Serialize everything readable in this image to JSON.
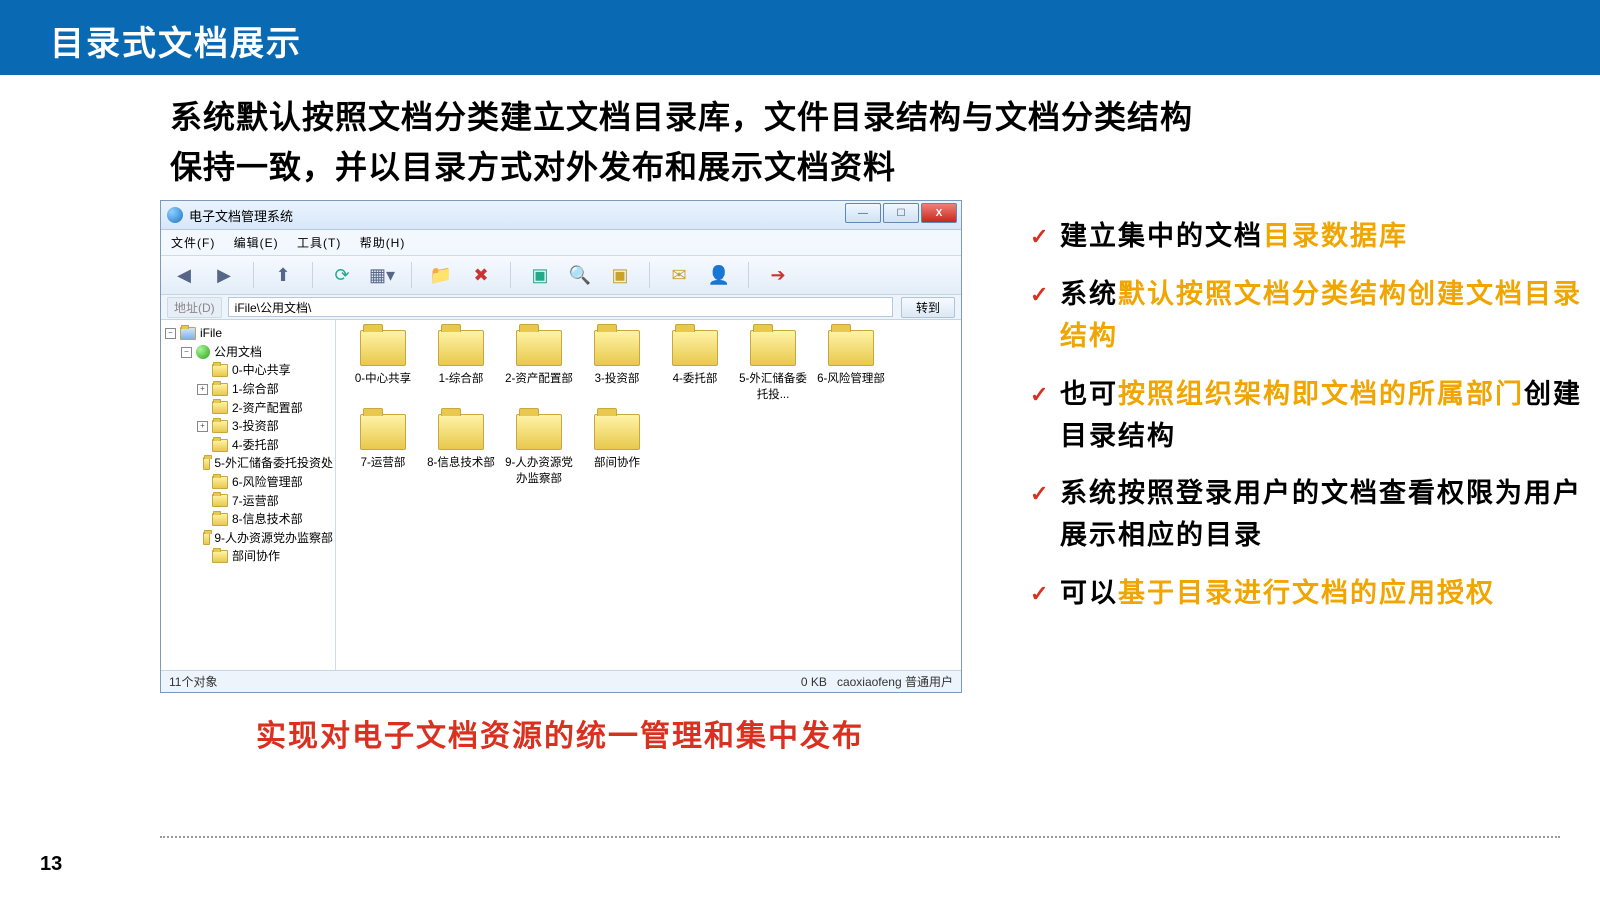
{
  "title": "目录式文档展示",
  "subtitle_l1": "系统默认按照文档分类建立文档目录库，文件目录结构与文档分类结构",
  "subtitle_l2": "保持一致，并以目录方式对外发布和展示文档资料",
  "window": {
    "title": "电子文档管理系统",
    "menus": [
      "文件(F)",
      "编辑(E)",
      "工具(T)",
      "帮助(H)"
    ],
    "address_label": "地址(D)",
    "address_value": "iFile\\公用文档\\",
    "go_label": "转到",
    "tree_root": "iFile",
    "tree_main": "公用文档",
    "tree_items": [
      "0-中心共享",
      "1-综合部",
      "2-资产配置部",
      "3-投资部",
      "4-委托部",
      "5-外汇储备委托投资处",
      "6-风险管理部",
      "7-运营部",
      "8-信息技术部",
      "9-人办资源党办监察部",
      "部间协作"
    ],
    "grid_items": [
      "0-中心共享",
      "1-综合部",
      "2-资产配置部",
      "3-投资部",
      "4-委托部",
      "5-外汇储备委托投...",
      "6-风险管理部",
      "7-运营部",
      "8-信息技术部",
      "9-人办资源党办监察部",
      "部间协作"
    ],
    "status_left": "11个对象",
    "status_mid": "0 KB",
    "status_right": "caoxiaofeng 普通用户"
  },
  "bullets": [
    {
      "pre": "建立集中的文档",
      "hl": "目录数据库",
      "post": ""
    },
    {
      "pre": "系统",
      "hl": "默认按照文档分类结构创建文档目录结构",
      "post": ""
    },
    {
      "pre": "也可",
      "hl": "按照组织架构即文档的所属部门",
      "post": "创建目录结构"
    },
    {
      "pre": "系统按照登录用户的文档查看权限为用户展示相应的目录",
      "hl": "",
      "post": ""
    },
    {
      "pre": "可以",
      "hl": "基于目录进行文档的应用授权",
      "post": ""
    }
  ],
  "punchline": "实现对电子文档资源的统一管理和集中发布",
  "page": "13"
}
